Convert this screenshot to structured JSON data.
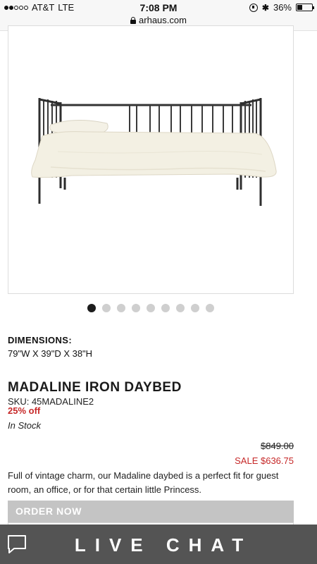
{
  "status_bar": {
    "carrier": "AT&T",
    "network": "LTE",
    "time": "7:08 PM",
    "url": "arhaus.com",
    "battery_percent": "36%",
    "battery_level": 0.36,
    "signal_bars_filled": 2,
    "signal_bars_total": 5
  },
  "gallery": {
    "image_count": 9,
    "active_index": 0
  },
  "product": {
    "dimensions_label": "DIMENSIONS:",
    "dimensions_value": "79\"W X 39\"D X 38\"H",
    "title": "MADALINE IRON DAYBED",
    "sku": "SKU: 45MADALINE2",
    "discount": "25% off",
    "stock": "In Stock",
    "original_price": "$849.00",
    "sale_price": "SALE $636.75",
    "description": "Full of vintage charm, our Madaline daybed is a perfect fit for guest room, an office, or for that certain little Princess."
  },
  "actions": {
    "order_label": "ORDER NOW",
    "live_chat_label": "LIVE CHAT"
  },
  "colors": {
    "sale_red": "#c62828",
    "order_button": "#c4c4c4",
    "chat_bar": "#545454"
  },
  "icons": {
    "lock": "lock-icon",
    "orientation_lock": "orientation-lock-icon",
    "bluetooth": "bluetooth-icon",
    "battery": "battery-icon",
    "chat": "chat-bubble-icon"
  }
}
